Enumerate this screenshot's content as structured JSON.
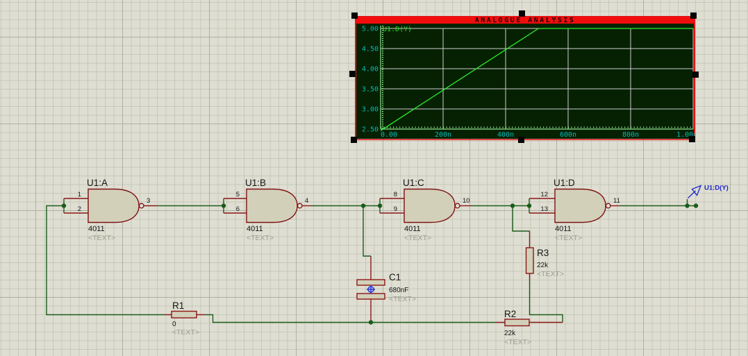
{
  "graph": {
    "title": "ANALOGUE ANALYSIS",
    "legend": "U1:D(Y)",
    "ytick_labels": [
      "5.00",
      "4.50",
      "4.00",
      "3.50",
      "3.00",
      "2.50"
    ],
    "xtick_labels": [
      "0.00",
      "200n",
      "400n",
      "600n",
      "800n",
      "1.00u"
    ]
  },
  "chart_data": {
    "type": "line",
    "title": "ANALOGUE ANALYSIS",
    "xlim": [
      0,
      1e-06
    ],
    "ylim": [
      2.5,
      5.0
    ],
    "xtick_values": [
      0,
      2e-07,
      4e-07,
      6e-07,
      8e-07,
      1e-06
    ],
    "ytick_values": [
      5.0,
      4.5,
      4.0,
      3.5,
      3.0,
      2.5
    ],
    "grid": true,
    "legend_position": "top-left",
    "series": [
      {
        "name": "U1:D(Y)",
        "color": "#2cee2c",
        "points": [
          [
            0,
            2.46
          ],
          [
            5.05e-07,
            5.0
          ],
          [
            1e-06,
            5.0
          ]
        ]
      }
    ]
  },
  "gates": [
    {
      "name": "U1:A",
      "part": "4011",
      "tag": "<TEXT>",
      "pin_in1": "1",
      "pin_in2": "2",
      "pin_out": "3"
    },
    {
      "name": "U1:B",
      "part": "4011",
      "tag": "<TEXT>",
      "pin_in1": "5",
      "pin_in2": "6",
      "pin_out": "4"
    },
    {
      "name": "U1:C",
      "part": "4011",
      "tag": "<TEXT>",
      "pin_in1": "8",
      "pin_in2": "9",
      "pin_out": "10"
    },
    {
      "name": "U1:D",
      "part": "4011",
      "tag": "<TEXT>",
      "pin_in1": "12",
      "pin_in2": "13",
      "pin_out": "11"
    }
  ],
  "components": {
    "r1": {
      "ref": "R1",
      "value": "0",
      "tag": "<TEXT>"
    },
    "r2": {
      "ref": "R2",
      "value": "22k",
      "tag": "<TEXT>"
    },
    "r3": {
      "ref": "R3",
      "value": "22k",
      "tag": "<TEXT>"
    },
    "c1": {
      "ref": "C1",
      "value": "680nF",
      "tag": "<TEXT>"
    }
  },
  "probe": {
    "label": "U1:D(Y)"
  },
  "colors": {
    "wire": "#1a5c1a",
    "pin": "#8c1616",
    "component_fill": "#d3d0ba",
    "graph_bg": "#062102",
    "title_bar": "#f20d0d",
    "axis_label": "#00bcbc",
    "trace": "#2cee2c",
    "probe_blue": "#2030cc"
  }
}
